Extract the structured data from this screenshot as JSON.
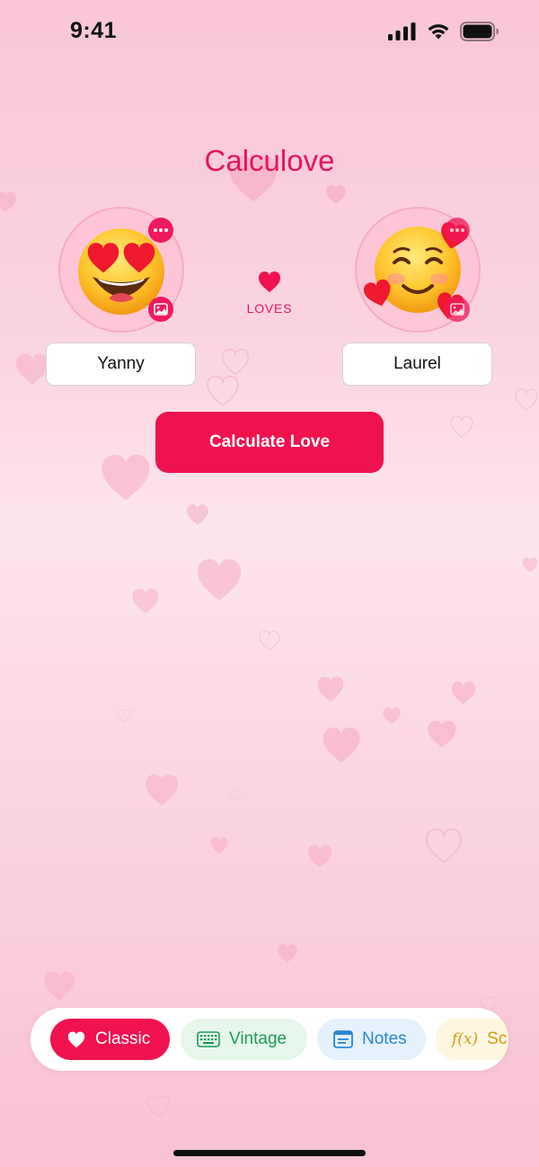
{
  "status_bar": {
    "time": "9:41"
  },
  "app": {
    "title": "Calculove"
  },
  "lovers": {
    "left": {
      "name": "Yanny",
      "emoji": "smiling-face-with-heart-eyes"
    },
    "right": {
      "name": "Laurel",
      "emoji": "smiling-face-with-hearts"
    },
    "connector_label": "LOVES"
  },
  "actions": {
    "calculate_label": "Calculate Love"
  },
  "tabs": [
    {
      "label": "Classic",
      "icon": "heart-icon",
      "active": true,
      "color": "#f0124f"
    },
    {
      "label": "Vintage",
      "icon": "keyboard-icon",
      "active": false,
      "color": "#1f9a57"
    },
    {
      "label": "Notes",
      "icon": "notes-icon",
      "active": false,
      "color": "#2a86d1"
    },
    {
      "label": "Sc",
      "icon": "function-icon",
      "icon_text": "f(x)",
      "active": false,
      "color": "#d59b12"
    }
  ],
  "theme": {
    "accent": "#f0124f",
    "title_color": "#e8155a"
  }
}
